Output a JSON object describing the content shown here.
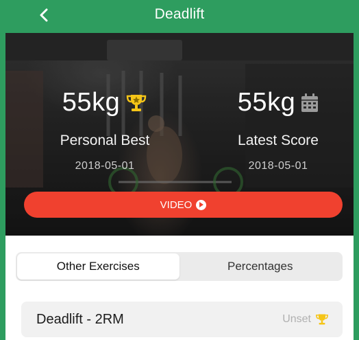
{
  "header": {
    "title": "Deadlift",
    "back_icon": "chevron-left-icon"
  },
  "hero": {
    "personal_best": {
      "value": "55kg",
      "label": "Personal Best",
      "date": "2018-05-01",
      "icon": "trophy-icon",
      "icon_color": "#f5c518"
    },
    "latest_score": {
      "value": "55kg",
      "label": "Latest Score",
      "date": "2018-05-01",
      "icon": "calendar-icon",
      "icon_color": "#9b9b9b"
    },
    "video_button": {
      "label": "VIDEO",
      "icon": "play-circle-icon",
      "color": "#f0412f"
    }
  },
  "tabs": [
    {
      "label": "Other Exercises",
      "active": true
    },
    {
      "label": "Percentages",
      "active": false
    }
  ],
  "exercises": [
    {
      "name": "Deadlift - 2RM",
      "status": "Unset",
      "icon": "trophy-icon",
      "icon_color": "#f5c518"
    }
  ],
  "colors": {
    "header_bg": "#2e9d5f",
    "accent_red": "#f0412f",
    "trophy_yellow": "#f5c518"
  }
}
